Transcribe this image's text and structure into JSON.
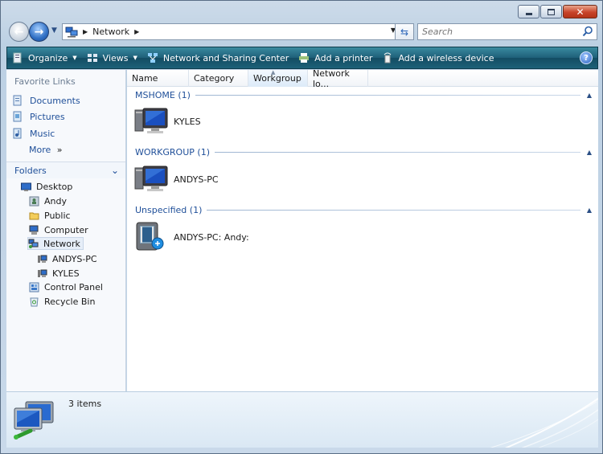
{
  "window": {
    "caption_buttons": {
      "minimize": "–",
      "maximize": "□",
      "close": "✕"
    }
  },
  "address": {
    "location": "Network",
    "search_placeholder": "Search"
  },
  "toolbar": {
    "organize": "Organize",
    "views": "Views",
    "network_sharing_center": "Network and Sharing Center",
    "add_printer": "Add a printer",
    "add_wireless": "Add a wireless device",
    "help": "?"
  },
  "nav": {
    "favorites_title": "Favorite Links",
    "favorites": [
      {
        "label": "Documents",
        "icon": "documents-icon"
      },
      {
        "label": "Pictures",
        "icon": "pictures-icon"
      },
      {
        "label": "Music",
        "icon": "music-icon"
      }
    ],
    "more": "More",
    "more_glyph": "»",
    "folders_title": "Folders",
    "tree": [
      {
        "label": "Desktop",
        "icon": "desktop-icon",
        "level": 0
      },
      {
        "label": "Andy",
        "icon": "user-folder-icon",
        "level": 1
      },
      {
        "label": "Public",
        "icon": "folder-icon",
        "level": 1
      },
      {
        "label": "Computer",
        "icon": "computer-icon",
        "level": 1
      },
      {
        "label": "Network",
        "icon": "network-icon",
        "level": 1,
        "selected": true
      },
      {
        "label": "ANDYS-PC",
        "icon": "pc-icon",
        "level": 2
      },
      {
        "label": "KYLES",
        "icon": "pc-icon",
        "level": 2
      },
      {
        "label": "Control Panel",
        "icon": "control-panel-icon",
        "level": 1
      },
      {
        "label": "Recycle Bin",
        "icon": "recycle-bin-icon",
        "level": 1
      }
    ]
  },
  "list": {
    "columns": [
      "Name",
      "Category",
      "Workgroup",
      "Network lo..."
    ],
    "sorted_column": "Workgroup",
    "groups": [
      {
        "title": "MSHOME (1)",
        "items": [
          "KYLES"
        ]
      },
      {
        "title": "WORKGROUP (1)",
        "items": [
          "ANDYS-PC"
        ]
      },
      {
        "title": "Unspecified (1)",
        "items": [
          "ANDYS-PC: Andy:"
        ]
      }
    ]
  },
  "details": {
    "count": "3 items"
  },
  "colors": {
    "accent": "#1f4f99",
    "command_bar": "#1e5f78",
    "group_title": "#1f4f99"
  }
}
